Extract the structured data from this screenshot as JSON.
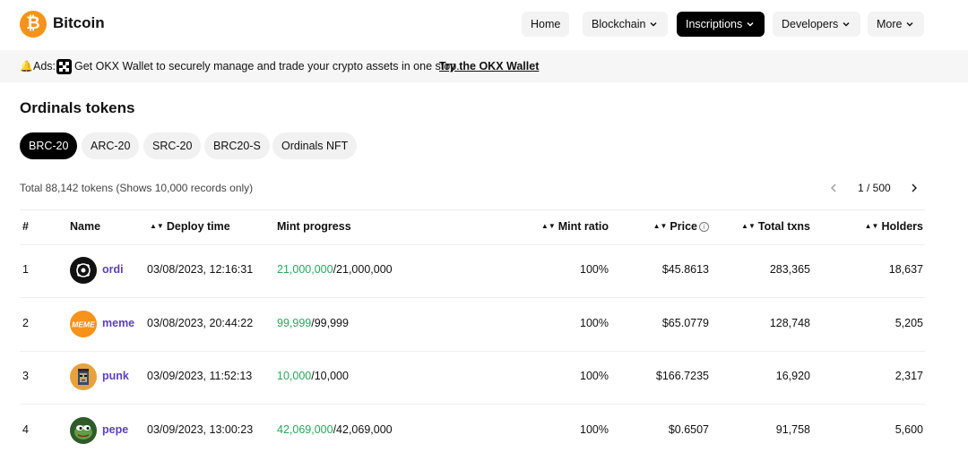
{
  "header": {
    "logo_letter": "₿",
    "brand": "Bitcoin",
    "nav": [
      "Home",
      "Blockchain",
      "Inscriptions",
      "Developers",
      "More"
    ]
  },
  "ads": {
    "label": "Ads:",
    "text": "Get OKX Wallet to securely manage and trade your crypto assets in one stop.",
    "link": "Try the OKX Wallet"
  },
  "page_title": "Ordinals tokens",
  "tabs": [
    "BRC-20",
    "ARC-20",
    "SRC-20",
    "BRC20-S",
    "Ordinals NFT"
  ],
  "summary": {
    "total": "Total 88,142 tokens (Shows 10,000 records only)",
    "pagination": "1 / 500"
  },
  "table": {
    "headers": {
      "index": "#",
      "name": "Name",
      "deploy_time": "Deploy time",
      "mint_progress": "Mint progress",
      "mint_ratio": "Mint ratio",
      "price": "Price",
      "total_txns": "Total txns",
      "holders": "Holders"
    },
    "rows": [
      {
        "index": "1",
        "name": "ordi",
        "deploy_time": "03/08/2023, 12:16:31",
        "minted": "21,000,000",
        "supply": "/21,000,000",
        "mint_ratio": "100%",
        "price": "$45.8613",
        "total_txns": "283,365",
        "holders": "18,637",
        "avatar_text": "{@}"
      },
      {
        "index": "2",
        "name": "meme",
        "deploy_time": "03/08/2023, 20:44:22",
        "minted": "99,999",
        "supply": "/99,999",
        "mint_ratio": "100%",
        "price": "$65.0779",
        "total_txns": "128,748",
        "holders": "5,205",
        "avatar_text": "MEME"
      },
      {
        "index": "3",
        "name": "punk",
        "deploy_time": "03/09/2023, 11:52:13",
        "minted": "10,000",
        "supply": "/10,000",
        "mint_ratio": "100%",
        "price": "$166.7235",
        "total_txns": "16,920",
        "holders": "2,317",
        "avatar_text": ""
      },
      {
        "index": "4",
        "name": "pepe",
        "deploy_time": "03/09/2023, 13:00:23",
        "minted": "42,069,000",
        "supply": "/42,069,000",
        "mint_ratio": "100%",
        "price": "$0.6507",
        "total_txns": "91,758",
        "holders": "5,600",
        "avatar_text": ""
      }
    ]
  },
  "colors": {
    "bitcoin_orange": "#f7931a",
    "link_purple": "#5b3fc4",
    "progress_green": "#2aa65a"
  }
}
